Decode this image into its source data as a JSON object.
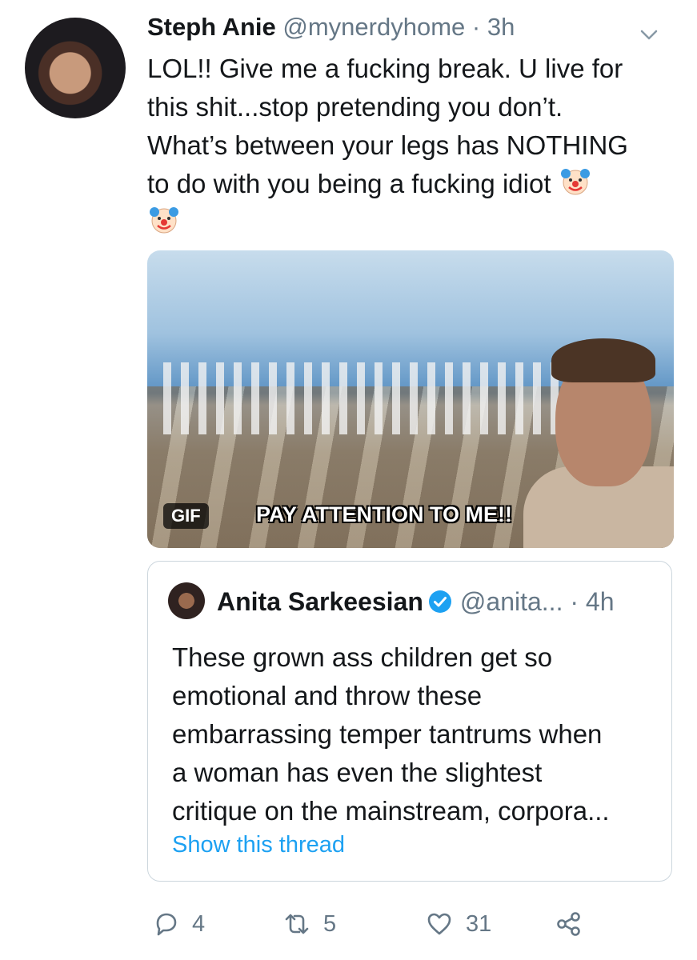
{
  "tweet": {
    "name": "Steph Anie",
    "handle": "@mynerdyhome",
    "separator": "·",
    "time": "3h",
    "text_line1": "LOL!! Give me a fucking break. U live for",
    "text_line2": "this shit...stop pretending you don’t.",
    "text_line3": "What’s between your legs has NOTHING",
    "text_line4": "to do with you being a fucking idiot",
    "emoji_icon": "clown-face-icon"
  },
  "media": {
    "badge": "GIF",
    "caption": "PAY ATTENTION TO ME!!"
  },
  "quoted": {
    "name": "Anita Sarkeesian",
    "verified_icon": "verified-badge-icon",
    "handle": "@anita...",
    "separator": "·",
    "time": "4h",
    "line1": "These grown ass children get so",
    "line2": "emotional and throw these",
    "line3": "embarrassing temper tantrums when",
    "line4": "a woman has even the slightest",
    "line5": "critique on the mainstream, corpora...",
    "show_thread": "Show this thread"
  },
  "actions": {
    "reply_count": "4",
    "retweet_count": "5",
    "like_count": "31"
  },
  "colors": {
    "accent": "#1da1f2",
    "secondary_text": "#657786",
    "border": "#ccd6dd"
  }
}
